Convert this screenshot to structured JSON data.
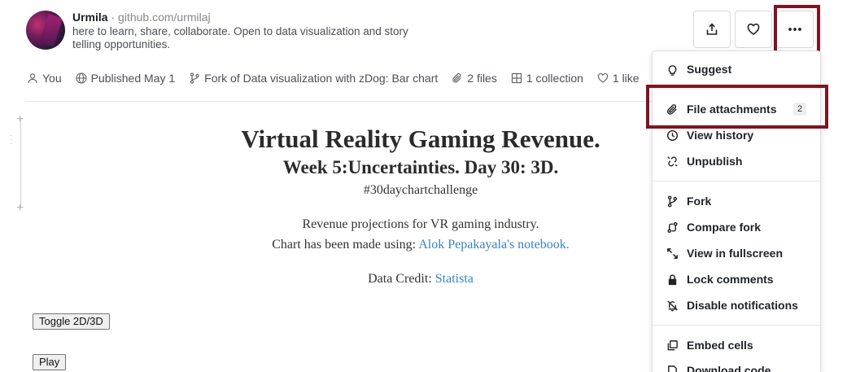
{
  "author": {
    "name": "Urmila",
    "separator": "·",
    "handle_url": "github.com/urmilaj",
    "bio": "here to learn, share, collaborate. Open to data visualization and story telling opportunities."
  },
  "meta": {
    "owner": "You",
    "published": "Published May 1",
    "fork_of": "Fork of Data visualization with zDog: Bar chart",
    "files": "2 files",
    "collections": "1 collection",
    "likes": "1 like"
  },
  "actions": {
    "share_icon": "share-icon",
    "like_icon": "heart-icon",
    "more_icon": "more-icon"
  },
  "notebook": {
    "title": "Virtual Reality Gaming Revenue.",
    "subtitle": "Week 5:Uncertainties. Day 30: 3D.",
    "hashtag": "#30daychartchallenge",
    "description": "Revenue projections for VR gaming industry.",
    "made_using_prefix": "Chart has been made using: ",
    "made_using_link": "Alok Pepakayala's notebook.",
    "credit_prefix": "Data Credit: ",
    "credit_link": "Statista",
    "toggle_button": "Toggle 2D/3D",
    "play_button": "Play"
  },
  "menu": {
    "items": [
      {
        "label": "Suggest",
        "icon": "lightbulb-icon"
      },
      {
        "label": "File attachments",
        "icon": "paperclip-icon",
        "badge": "2"
      },
      {
        "label": "View history",
        "icon": "clock-icon"
      },
      {
        "label": "Unpublish",
        "icon": "unlink-icon"
      },
      {
        "label": "Fork",
        "icon": "fork-icon"
      },
      {
        "label": "Compare fork",
        "icon": "compare-icon"
      },
      {
        "label": "View in fullscreen",
        "icon": "fullscreen-icon"
      },
      {
        "label": "Lock comments",
        "icon": "lock-icon"
      },
      {
        "label": "Disable notifications",
        "icon": "bell-off-icon"
      },
      {
        "label": "Embed cells",
        "icon": "embed-icon"
      },
      {
        "label": "Download code",
        "icon": "download-icon"
      }
    ]
  },
  "colors": {
    "highlight": "#7d1522",
    "link": "#3b82c4"
  }
}
